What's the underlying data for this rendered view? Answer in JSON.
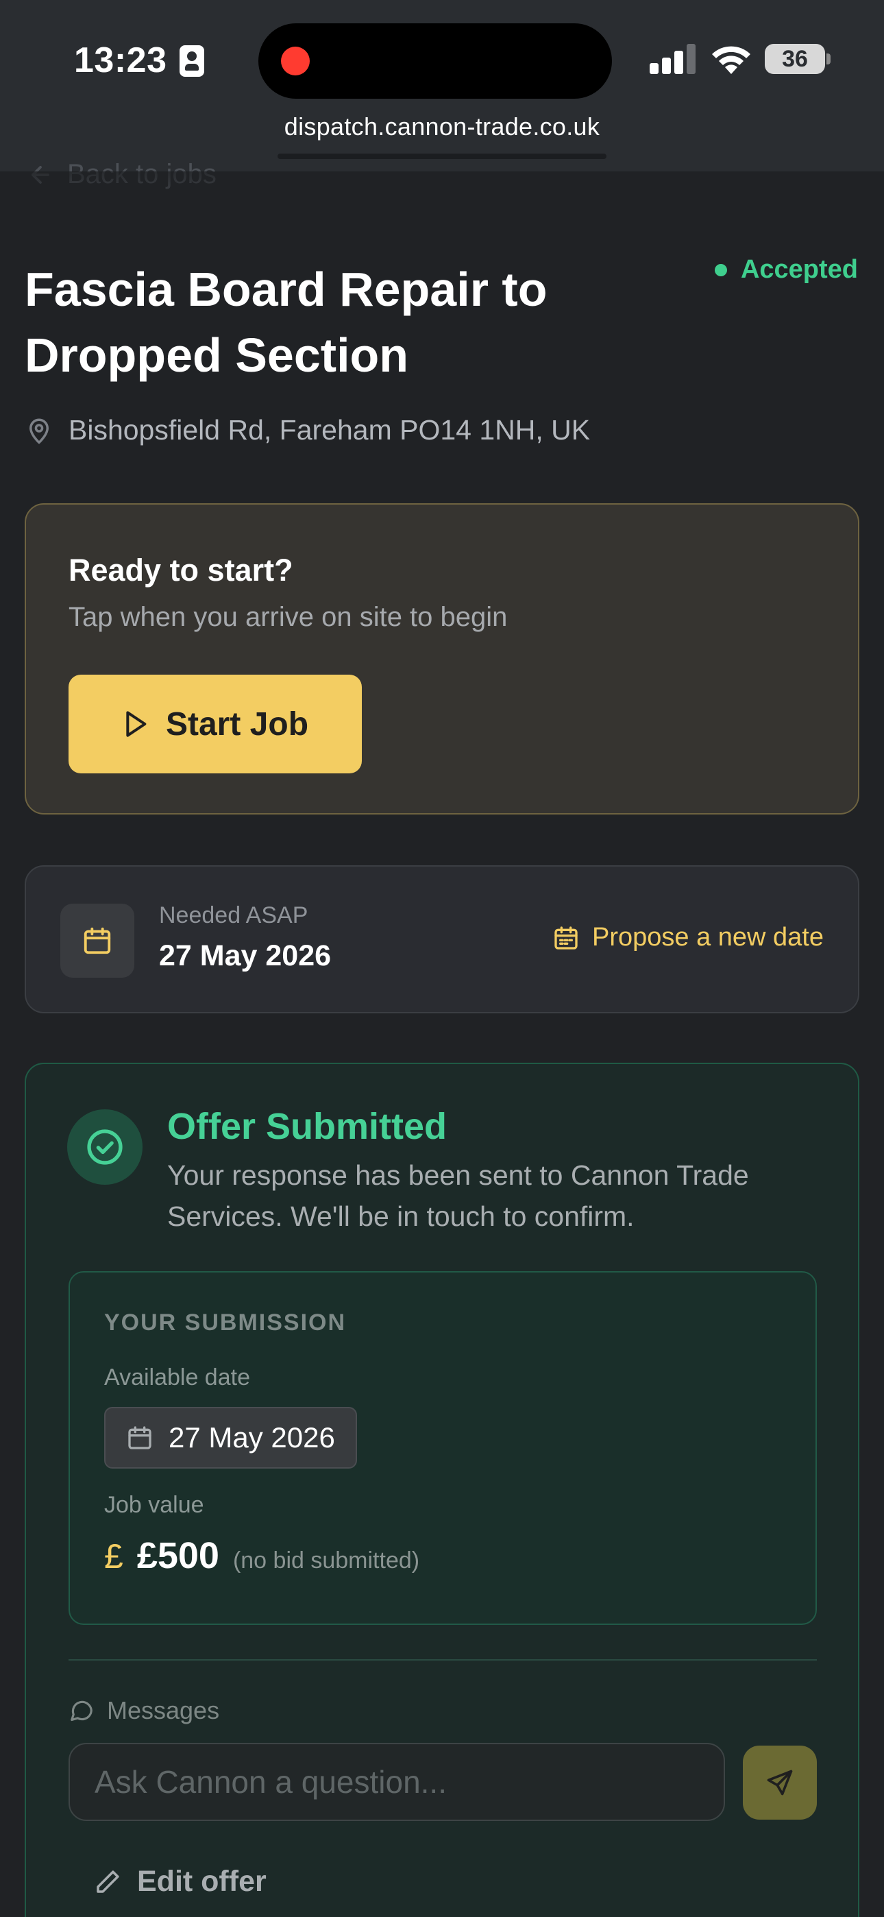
{
  "status_bar": {
    "time": "13:23",
    "battery": "36",
    "url": "dispatch.cannon-trade.co.uk"
  },
  "nav": {
    "back_label": "Back to jobs"
  },
  "job": {
    "title": "Fascia Board Repair to Dropped Section",
    "status": "Accepted",
    "address": "Bishopsfield Rd, Fareham PO14 1NH, UK"
  },
  "ready_card": {
    "title": "Ready to start?",
    "subtitle": "Tap when you arrive on site to begin",
    "start_button": "Start Job"
  },
  "date_card": {
    "label": "Needed ASAP",
    "date": "27 May 2026",
    "propose_label": "Propose a new date"
  },
  "offer": {
    "title": "Offer Submitted",
    "description": "Your response has been sent to Cannon Trade Services. We'll be in touch to confirm.",
    "submission": {
      "heading": "YOUR SUBMISSION",
      "available_date_label": "Available date",
      "available_date": "27 May 2026",
      "job_value_label": "Job value",
      "currency_symbol": "£",
      "job_value": "£500",
      "bid_note": "(no bid submitted)"
    },
    "messages": {
      "label": "Messages",
      "placeholder": "Ask Cannon a question..."
    },
    "edit_label": "Edit offer"
  },
  "colors": {
    "background": "#202225",
    "accent_yellow": "#f3cd62",
    "accent_green": "#3fcf8e"
  },
  "icons": {
    "back": "arrow-left-icon",
    "location": "map-pin-icon",
    "start": "play-icon",
    "calendar": "calendar-icon",
    "offer": "check-circle-icon",
    "messages": "chat-bubble-icon",
    "send": "send-icon",
    "edit": "pencil-icon"
  }
}
